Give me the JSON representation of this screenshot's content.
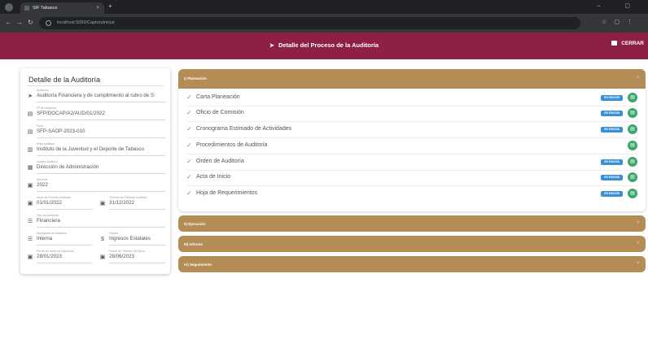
{
  "browser": {
    "tab_title": "SIF Tabasco",
    "tab_close": "×",
    "new_tab": "+",
    "window_controls": "–  ▢",
    "url": "localhost:5050/CapturaInicial"
  },
  "header": {
    "title": "Detalle del Proceso de la Auditoría",
    "close_label": "CERRAR",
    "background": "#8e1f45"
  },
  "detail_card": {
    "title": "Detalle de la Auditoría",
    "fields": [
      {
        "label": "Auditoría",
        "value": "Auditoría Financiera y de cumplimiento al rubro de S",
        "icon": "chevron-right-icon"
      },
      {
        "label": "Nº de Auditoría",
        "value": "SFP/DGCAP/A2/AUD/01/2022",
        "icon": "id-card-icon"
      },
      {
        "label": "Folio",
        "value": "SFP-SAOP-2023-010",
        "icon": "id-card-icon"
      },
      {
        "label": "Ente Auditado",
        "value": "Instituto de la Juventud y el Deporte de Tabasco",
        "icon": "building-icon"
      },
      {
        "label": "Unidad Auditora",
        "value": "Dirección de Administración",
        "icon": "office-icon"
      },
      {
        "label": "Ejercicio",
        "value": "2022",
        "icon": "calendar-icon"
      },
      {
        "label": "Inicio de Periodo Auditado",
        "value": "01/01/2022",
        "icon": "calendar-icon"
      },
      {
        "label": "Término de Periodo Auditado",
        "value": "31/12/2022",
        "icon": "calendar-icon"
      },
      {
        "label": "Tipo de Auditoría",
        "value": "Financiera",
        "icon": "list-icon"
      },
      {
        "label": "Modalidad de Auditoría",
        "value": "Interna",
        "icon": "list-icon"
      },
      {
        "label": "Fuente",
        "value": "Ingresos Estatales",
        "icon": "money-icon"
      },
      {
        "label": "Fecha de Inicio de Ejecución",
        "value": "28/01/2023",
        "icon": "calendar-icon"
      },
      {
        "label": "Fecha de Término de Ejecu.",
        "value": "28/06/2023",
        "icon": "calendar-icon"
      }
    ]
  },
  "accordion": {
    "color": "#b48c56",
    "sections": [
      {
        "title": "I) Planeación",
        "chevron": "˄"
      },
      {
        "title": "II) Ejecución",
        "chevron": "˅"
      },
      {
        "title": "III) Informe",
        "chevron": "˅"
      },
      {
        "title": "IV) Seguimiento",
        "chevron": "˅"
      }
    ],
    "items": [
      {
        "text": "Carta Planeación",
        "badge": "EN EDICIÓN",
        "button_icon": "document-icon"
      },
      {
        "text": "Oficio de Comisión",
        "badge": "EN EDICIÓN",
        "button_icon": "document-icon"
      },
      {
        "text": "Cronograma Estimado de Actividades",
        "badge": "EN EDICIÓN",
        "button_icon": "document-icon"
      },
      {
        "text": "Procedimientos de Auditoría",
        "badge": "",
        "button_icon": "document-icon"
      },
      {
        "text": "Orden de Auditoría",
        "badge": "EN EDICIÓN",
        "button_icon": "document-icon"
      },
      {
        "text": "Acta de Inicio",
        "badge": "EN EDICIÓN",
        "button_icon": "document-icon"
      },
      {
        "text": "Hoja de Requerimientos",
        "badge": "EN EDICIÓN",
        "button_icon": "document-icon"
      }
    ],
    "check_glyph": "✓",
    "item_button_glyph": "▤"
  }
}
